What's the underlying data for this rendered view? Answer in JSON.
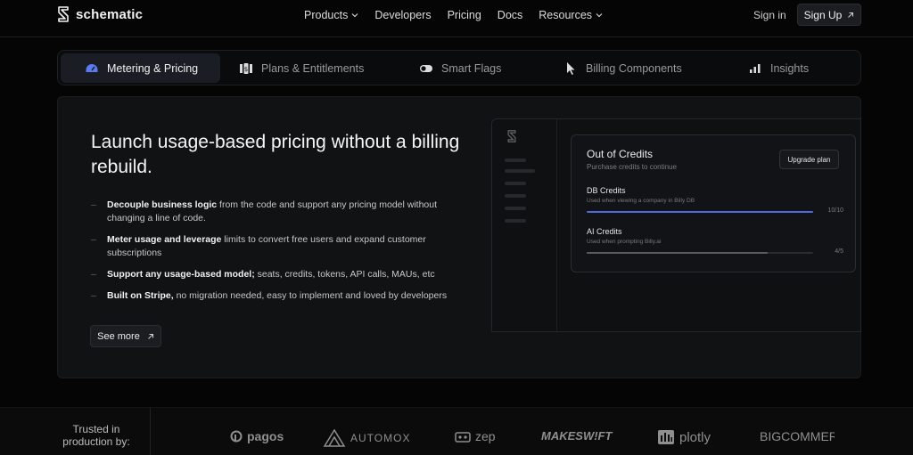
{
  "nav": {
    "brand": "schematic",
    "links": [
      "Products",
      "Developers",
      "Pricing",
      "Docs",
      "Resources"
    ],
    "sign_in": "Sign in",
    "sign_up": "Sign Up"
  },
  "tabs": [
    {
      "label": "Metering & Pricing",
      "icon": "gauge-icon",
      "active": true
    },
    {
      "label": "Plans & Entitlements",
      "icon": "plans-icon",
      "active": false
    },
    {
      "label": "Smart Flags",
      "icon": "toggle-icon",
      "active": false
    },
    {
      "label": "Billing Components",
      "icon": "cursor-icon",
      "active": false
    },
    {
      "label": "Insights",
      "icon": "bar-chart-icon",
      "active": false
    }
  ],
  "hero": {
    "headline": "Launch usage-based pricing without a billing rebuild.",
    "bullets": [
      {
        "bold": "Decouple business logic",
        "rest": " from the code and support any pricing model without changing a line of code."
      },
      {
        "bold": "Meter usage and leverage",
        "rest": " limits to convert free users and expand customer subscriptions"
      },
      {
        "bold": "Support any usage-based model;",
        "rest": " seats, credits, tokens, API calls, MAUs, etc"
      },
      {
        "bold": "Built on Stripe,",
        "rest": " no migration needed, easy to implement and loved by developers"
      }
    ],
    "see_more": "See more"
  },
  "mockup": {
    "title": "Out of Credits",
    "subtitle": "Purchase credits to continue",
    "upgrade": "Upgrade plan",
    "credits": [
      {
        "name": "DB Credits",
        "desc": "Used when viewing a company in Billy DB",
        "value": "10/10",
        "fraction": 1.0,
        "color": "#4e6be0"
      },
      {
        "name": "AI Credits",
        "desc": "Used when prompting Billy.ai",
        "value": "4/5",
        "fraction": 0.8,
        "color": "#5a5c61"
      }
    ]
  },
  "trusted": {
    "label": "Trusted in production by:",
    "brands": [
      "pagos",
      "AUTOMOX",
      "zep",
      "MAKESW!FT",
      "plotly",
      "BIGCOMMERCE"
    ]
  }
}
